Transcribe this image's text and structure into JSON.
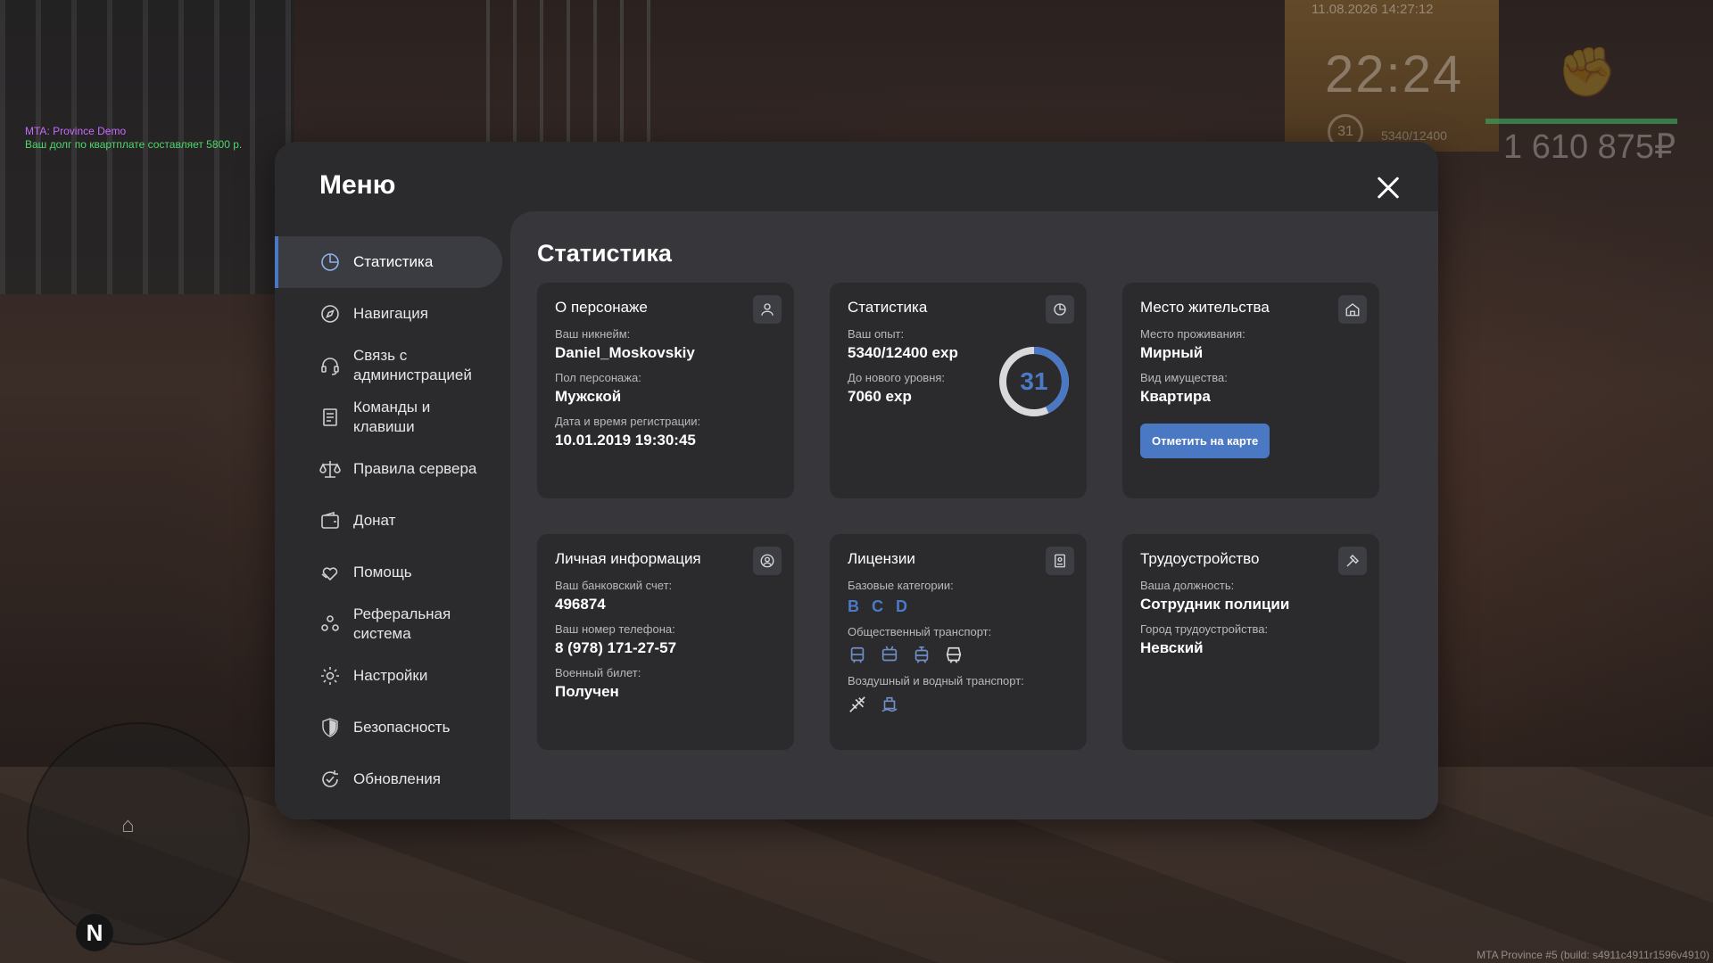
{
  "hud": {
    "server_line": "MTA: Province Demo",
    "debt_line": "Ваш долг по квартплате составляет 5800 р.",
    "datetime": "11.08.2026 14:27:12",
    "clock": "22:24",
    "level": "31",
    "exp": "5340/12400",
    "money": "1 610 875₽",
    "compass": "N",
    "build": "MTA Province #5 (build: s4911c4911r1596v4910)"
  },
  "menu": {
    "title": "Меню",
    "sidebar": [
      {
        "label": "Статистика",
        "icon": "pie-chart-icon"
      },
      {
        "label": "Навигация",
        "icon": "compass-icon"
      },
      {
        "label": "Связь с администрацией",
        "icon": "headset-icon"
      },
      {
        "label": "Команды и клавиши",
        "icon": "document-icon"
      },
      {
        "label": "Правила сервера",
        "icon": "scales-icon"
      },
      {
        "label": "Донат",
        "icon": "wallet-icon"
      },
      {
        "label": "Помощь",
        "icon": "heart-hand-icon"
      },
      {
        "label": "Реферальная система",
        "icon": "users-icon"
      },
      {
        "label": "Настройки",
        "icon": "gear-icon"
      },
      {
        "label": "Безопасность",
        "icon": "shield-icon"
      },
      {
        "label": "Обновления",
        "icon": "refresh-check-icon"
      }
    ],
    "active_index": 0
  },
  "content": {
    "title": "Статистика",
    "about": {
      "title": "О персонаже",
      "nick_label": "Ваш никнейм:",
      "nick": "Daniel_Moskovskiy",
      "gender_label": "Пол персонажа:",
      "gender": "Мужской",
      "reg_label": "Дата и время регистрации:",
      "reg": "10.01.2019 19:30:45"
    },
    "stats": {
      "title": "Статистика",
      "exp_label": "Ваш опыт:",
      "exp": "5340/12400 exp",
      "next_label": "До нового уровня:",
      "next": "7060 exp",
      "level": "31",
      "progress": 0.43
    },
    "residence": {
      "title": "Место жительства",
      "place_label": "Место проживания:",
      "place": "Мирный",
      "type_label": "Вид имущества:",
      "type": "Квартира",
      "button": "Отметить на карте"
    },
    "personal": {
      "title": "Личная информация",
      "bank_label": "Ваш банковский счет:",
      "bank": "496874",
      "phone_label": "Ваш номер телефона:",
      "phone": "8 (978) 171-27-57",
      "military_label": "Военный билет:",
      "military": "Получен"
    },
    "licenses": {
      "title": "Лицензии",
      "base_label": "Базовые категории:",
      "categories": [
        "B",
        "C",
        "D"
      ],
      "public_label": "Общественный транспорт:",
      "air_label": "Воздушный и водный транспорт:"
    },
    "employment": {
      "title": "Трудоустройство",
      "position_label": "Ваша должность:",
      "position": "Сотрудник полиции",
      "city_label": "Город трудоустройства:",
      "city": "Невский"
    }
  },
  "colors": {
    "accent": "#4b78c2",
    "panel": "#2b2b2e",
    "content_bg": "#37373b"
  }
}
